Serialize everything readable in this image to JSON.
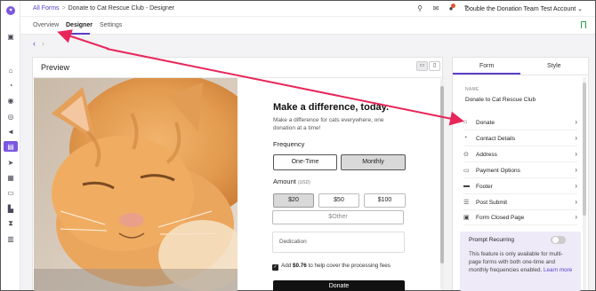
{
  "app": {
    "logo_icon": "heart-logo-icon",
    "accent_color": "#5a3ec8",
    "annotation_color": "#e8265a"
  },
  "topbar": {
    "breadcrumb_root": "All Forms",
    "breadcrumb_separator": ">",
    "breadcrumb_current": "Donate to Cat Rescue Club - Designer",
    "account_name": "Double the Donation Team Test Account",
    "account_chevron": "⌄"
  },
  "tabs": [
    {
      "label": "Overview"
    },
    {
      "label": "Designer"
    },
    {
      "label": "Settings"
    }
  ],
  "nav": {
    "back": "‹",
    "forward": "›"
  },
  "preview": {
    "title": "Preview",
    "desktop_icon": "▭",
    "mobile_icon": "▯"
  },
  "form": {
    "headline": "Make a difference, today.",
    "subtext": "Make a difference for cats everywhere, one donation at a time!",
    "frequency_label": "Frequency",
    "frequency_options": [
      "One-Time",
      "Monthly"
    ],
    "frequency_selected": "Monthly",
    "amount_label": "Amount",
    "amount_currency": "(USD)",
    "amounts": [
      "$20",
      "$50",
      "$100"
    ],
    "amount_selected": "$20",
    "other_label": "$Other",
    "dedication_label": "Dedication",
    "cover_fees_text_pre": "Add ",
    "cover_fees_amount": "$0.76",
    "cover_fees_text_post": " to help cover the processing fees",
    "cover_fees_checked": true,
    "donate_button": "Donate"
  },
  "right_panel": {
    "tabs": [
      "Form",
      "Style"
    ],
    "active_tab": "Form",
    "name_label": "NAME",
    "name_value": "Donate to Cat Rescue Club",
    "sections": [
      {
        "label": "Donate",
        "icon": "bank-icon"
      },
      {
        "label": "Contact Details",
        "icon": "person-icon"
      },
      {
        "label": "Address",
        "icon": "map-pin-icon"
      },
      {
        "label": "Payment Options",
        "icon": "credit-card-icon"
      },
      {
        "label": "Footer",
        "icon": "footer-icon"
      },
      {
        "label": "Post Submit",
        "icon": "checklist-icon"
      },
      {
        "label": "Form Closed Page",
        "icon": "closed-page-icon"
      }
    ],
    "prompt": {
      "title": "Prompt Recurring",
      "enabled": false,
      "text": "This feature is only available for multi-page forms with both one-time and monthly frequencies enabled.",
      "link": "Learn more"
    }
  }
}
